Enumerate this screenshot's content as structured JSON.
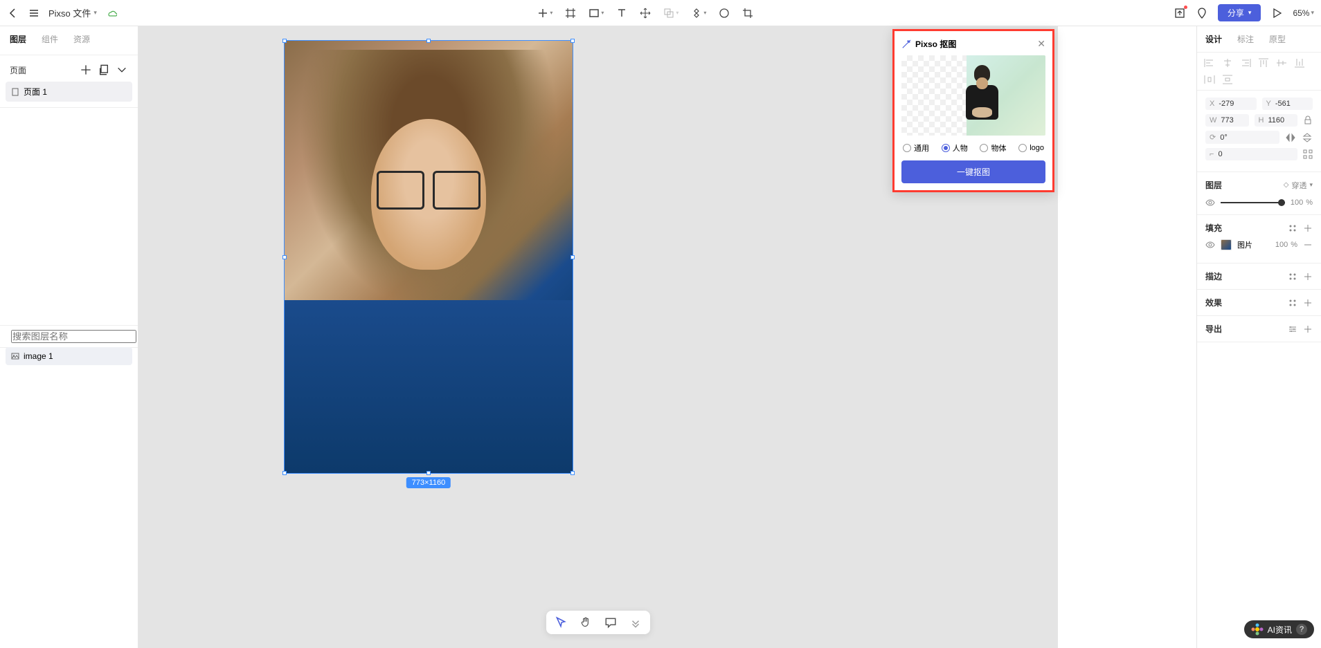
{
  "topbar": {
    "file_name": "Pixso 文件",
    "share_label": "分享",
    "zoom": "65%"
  },
  "left": {
    "tabs": [
      "图层",
      "组件",
      "资源"
    ],
    "pages_label": "页面",
    "pages": [
      "页面 1"
    ],
    "search_placeholder": "搜索图层名称",
    "layers": [
      "image 1"
    ]
  },
  "canvas": {
    "size_label": "773×1160"
  },
  "popup": {
    "title": "Pixso 抠图",
    "radios": [
      "通用",
      "人物",
      "物体",
      "logo"
    ],
    "selected_radio": 1,
    "button": "一键抠图"
  },
  "right": {
    "tabs": [
      "设计",
      "标注",
      "原型"
    ],
    "x": "-279",
    "y": "-561",
    "w": "773",
    "h": "1160",
    "rotation": "0°",
    "radius": "0",
    "layer_title": "图层",
    "layer_mode": "穿透",
    "opacity_val": "100",
    "opacity_unit": "%",
    "fill_title": "填充",
    "fill_label": "图片",
    "fill_opacity": "100",
    "fill_unit": "%",
    "stroke_title": "描边",
    "effect_title": "效果",
    "export_title": "导出"
  },
  "help": {
    "label": "AI资讯"
  }
}
